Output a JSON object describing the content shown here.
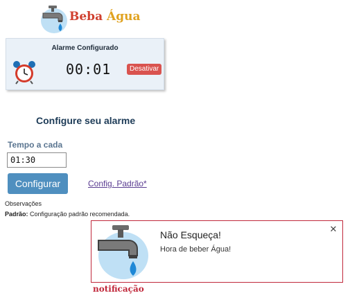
{
  "logo": {
    "brand_part1": "Beba",
    "brand_part2": "Água",
    "icon": "faucet-icon",
    "colors": {
      "beba": "#d0402f",
      "agua": "#e0a21f"
    }
  },
  "alarm_panel": {
    "title": "Alarme Configurado",
    "icon": "alarm-clock-icon",
    "time": "00:01",
    "deactivate_label": "Desativar"
  },
  "config": {
    "heading": "Configure seu alarme",
    "interval_label": "Tempo a cada",
    "interval_value": "01:30",
    "configure_label": "Configurar",
    "default_link": "Config. Padrão*",
    "notes_label": "Observações",
    "notes_prefix": "Padrão:",
    "notes_text": " Configuração padrão recomendada."
  },
  "notification": {
    "icon": "faucet-icon",
    "title": "Não Esqueça!",
    "body": "Hora de beber Água!",
    "close_icon": "close-icon",
    "caption": "notificação",
    "border_color": "#c0273a"
  },
  "colors": {
    "primary_button": "#4f8fbf",
    "danger_button": "#d9534f",
    "panel_bg": "#eaf1f8"
  }
}
